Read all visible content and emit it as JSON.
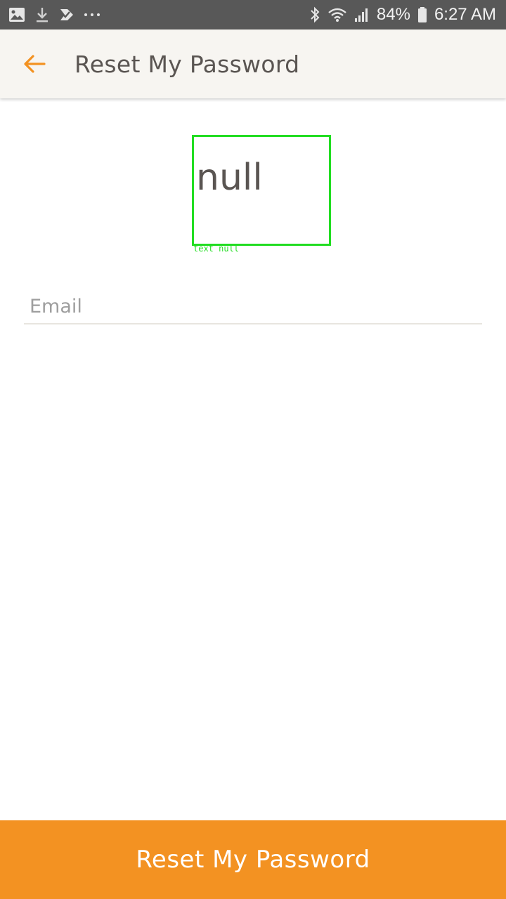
{
  "status_bar": {
    "icons_left": [
      "image-icon",
      "download-icon",
      "checkmark-app-icon",
      "more-dots-icon"
    ],
    "icons_right": [
      "bluetooth-icon",
      "wifi-icon",
      "signal-icon",
      "battery-icon"
    ],
    "battery": "84%",
    "time": "6:27 AM"
  },
  "app_bar": {
    "back_icon": "arrow-left-icon",
    "title": "Reset My Password"
  },
  "logo": {
    "text": "null",
    "caption": "text null"
  },
  "form": {
    "email_placeholder": "Email",
    "email_value": ""
  },
  "footer": {
    "reset_button_label": "Reset My Password"
  },
  "colors": {
    "accent": "#f39222",
    "app_bar_bg": "#f7f5f1",
    "status_bar_bg": "#585858",
    "title_text": "#5a5552",
    "debug_outline": "#22dd22"
  }
}
